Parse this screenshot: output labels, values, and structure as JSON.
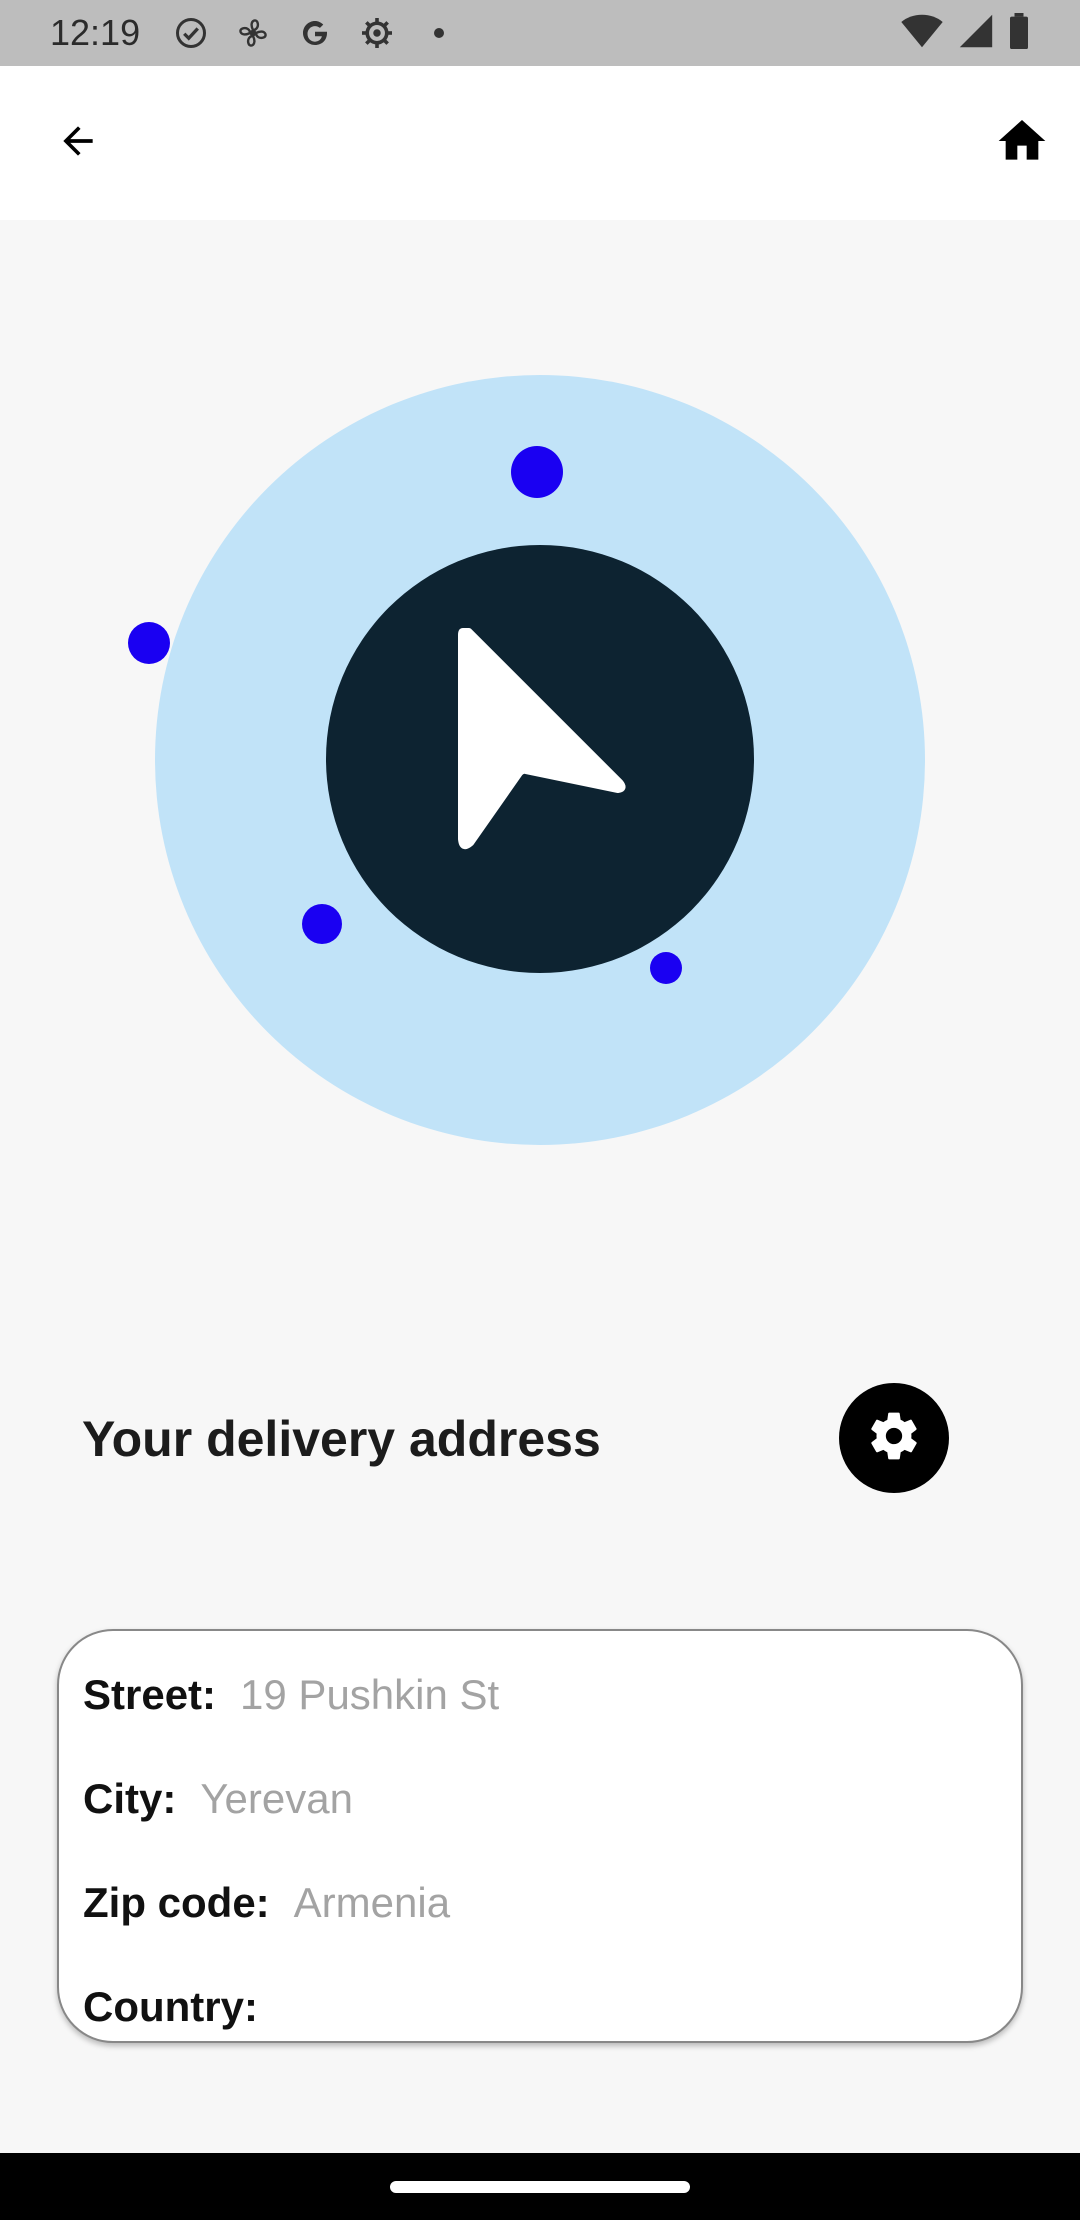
{
  "status_bar": {
    "time": "12:19",
    "icons_left": [
      "check-circle-icon",
      "fan-icon",
      "google-icon",
      "settings-gear-icon",
      "dot-icon"
    ],
    "icons_right": [
      "wifi-icon",
      "cell-signal-icon",
      "battery-icon"
    ]
  },
  "app_bar": {
    "back_icon": "arrow-left-icon",
    "home_icon": "home-icon"
  },
  "illustration": {
    "icon": "navigation-arrow-icon",
    "outer_color": "#c1e3f8",
    "inner_color": "#0d2331",
    "dot_color": "#1a00f2"
  },
  "section": {
    "title": "Your delivery address",
    "settings_icon": "gear-icon"
  },
  "address": {
    "fields": [
      {
        "label": "Street:",
        "value": "19 Pushkin St"
      },
      {
        "label": "City:",
        "value": "Yerevan"
      },
      {
        "label": "Zip code:",
        "value": "Armenia"
      },
      {
        "label": "Country:",
        "value": ""
      }
    ]
  }
}
